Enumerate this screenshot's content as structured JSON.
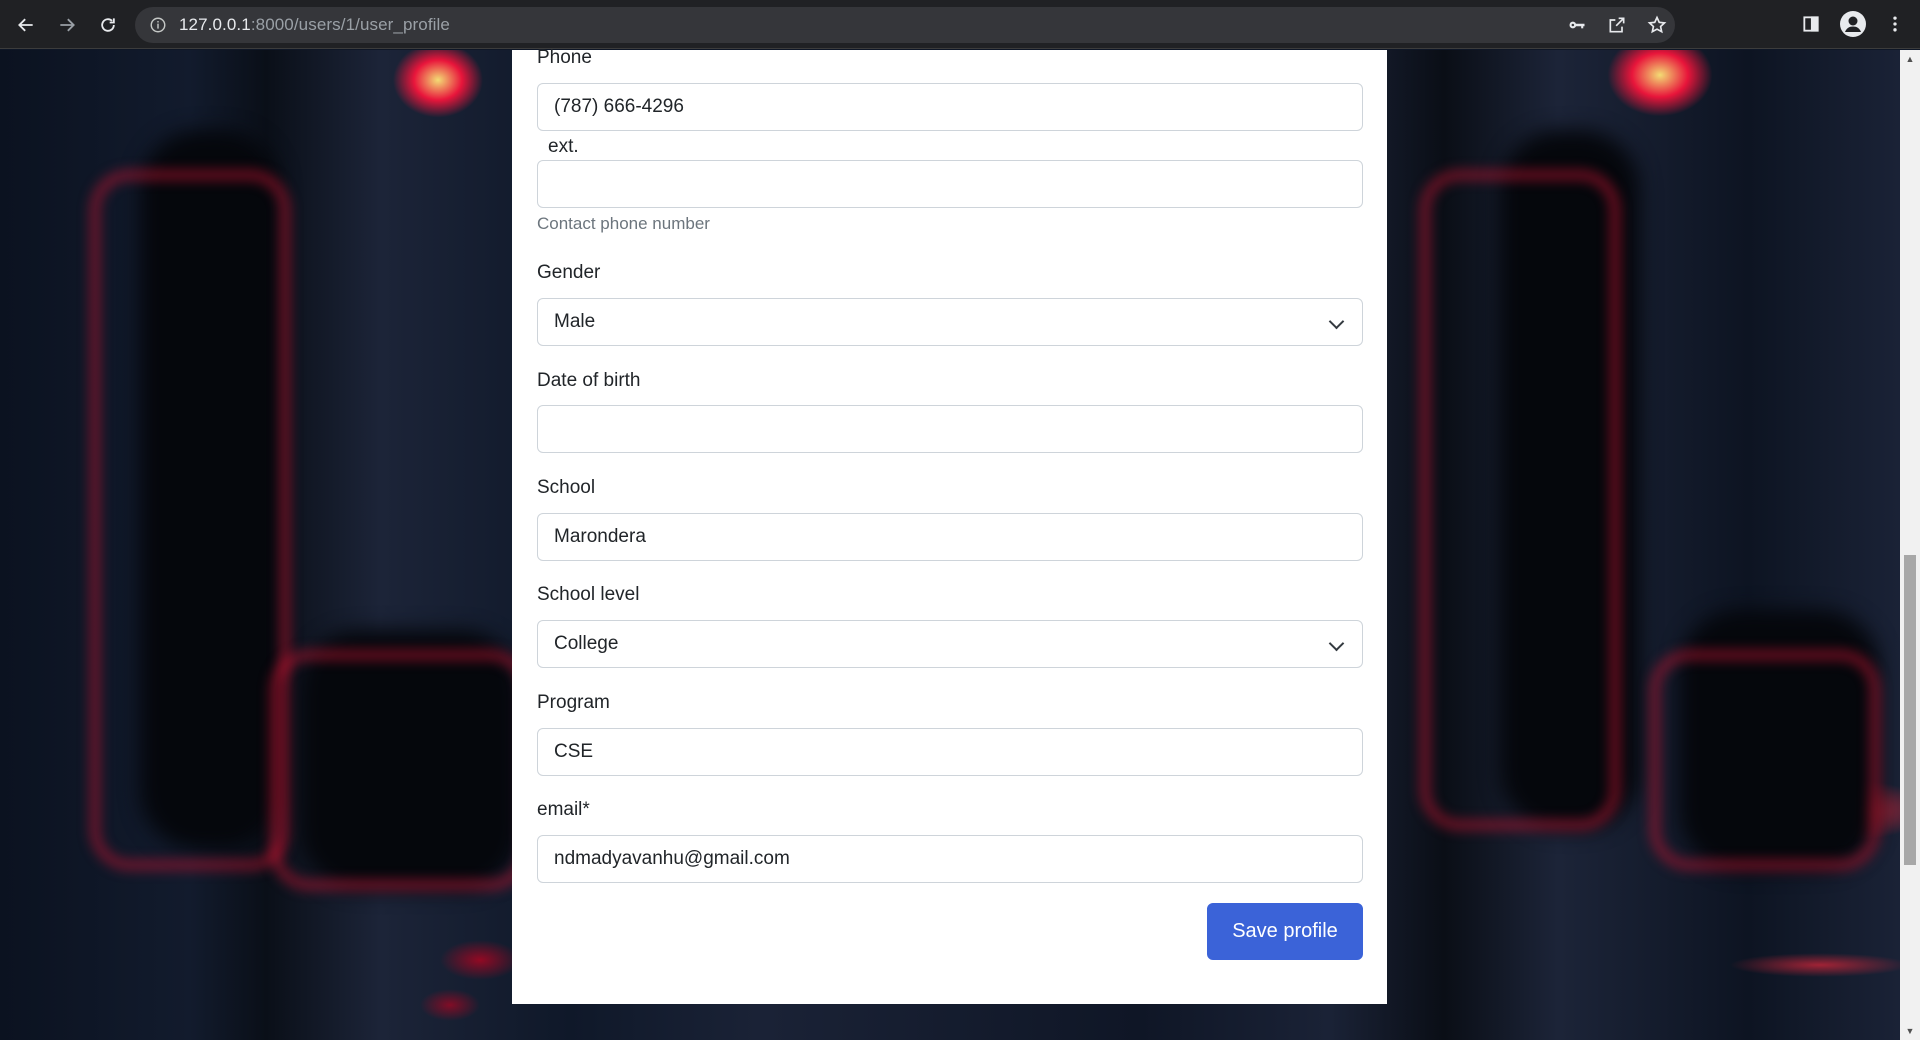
{
  "browser": {
    "url_host": "127.0.0.1",
    "url_rest": ":8000/users/1/user_profile",
    "icons": [
      "back-icon",
      "forward-icon",
      "reload-icon",
      "info-icon",
      "key-icon",
      "share-icon",
      "star-icon",
      "sidepanel-icon",
      "profile-icon",
      "menu-icon"
    ]
  },
  "form": {
    "phone_label": "Phone",
    "phone_value": "(787) 666-4296",
    "ext_label": "ext.",
    "ext_value": "",
    "phone_help": "Contact phone number",
    "gender_label": "Gender",
    "gender_value": "Male",
    "dob_label": "Date of birth",
    "dob_value": "",
    "school_label": "School",
    "school_value": "Marondera",
    "school_level_label": "School level",
    "school_level_value": "College",
    "program_label": "Program",
    "program_value": "CSE",
    "email_label": "email*",
    "email_value": "ndmadyavanhu@gmail.com",
    "save_label": "Save profile"
  },
  "colors": {
    "primary_button": "#3b63d8",
    "chrome_bg": "#202124"
  }
}
